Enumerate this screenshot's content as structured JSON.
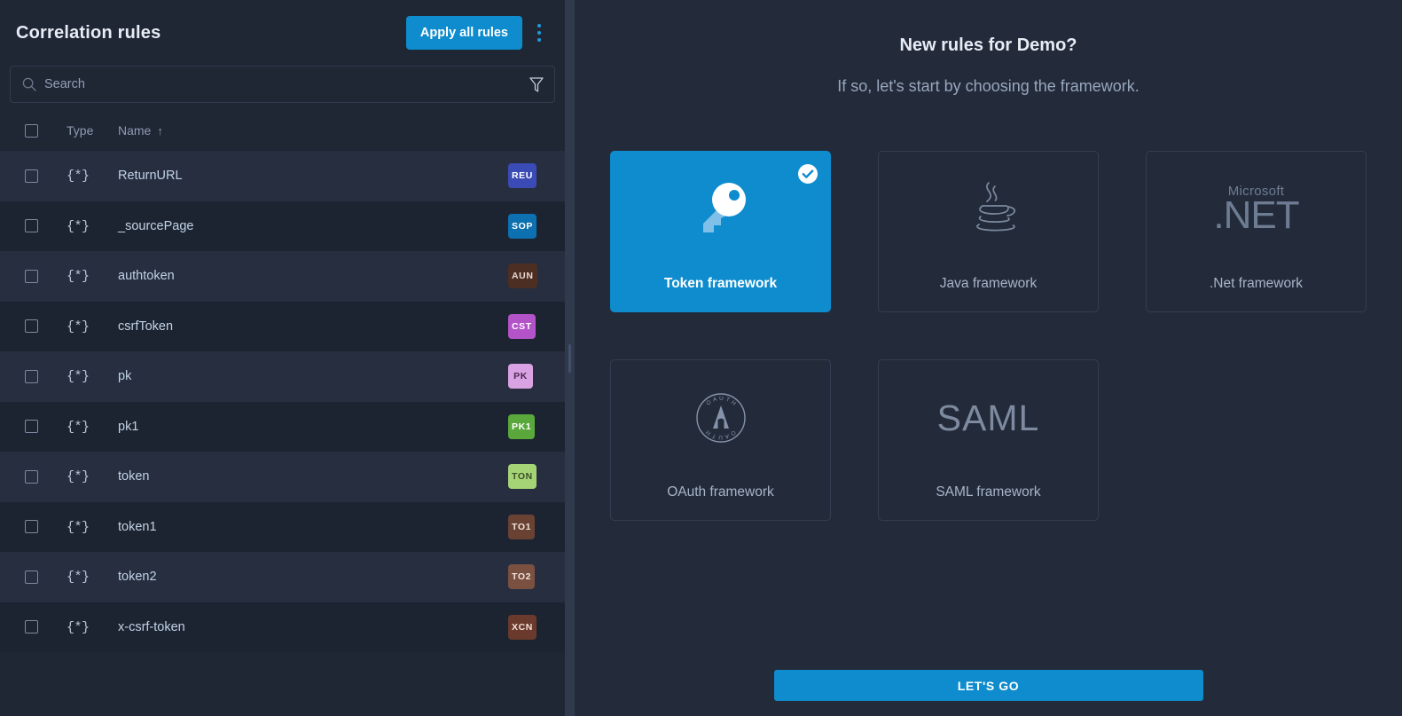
{
  "left": {
    "title": "Correlation rules",
    "apply_label": "Apply all rules",
    "kebab_icon": "more-vertical-icon",
    "search": {
      "placeholder": "Search",
      "value": "",
      "search_icon": "search-icon",
      "filter_icon": "filter-funnel-icon"
    },
    "columns": {
      "type": "Type",
      "name": "Name",
      "sort_indicator": "↑"
    },
    "type_glyph": "{*}",
    "rows": [
      {
        "name": "ReturnURL",
        "type": "{*}",
        "badge": "REU",
        "badge_bg": "#3b4bb5",
        "badge_fg": "#ffffff"
      },
      {
        "name": "_sourcePage",
        "type": "{*}",
        "badge": "SOP",
        "badge_bg": "#0d70b0",
        "badge_fg": "#ffffff"
      },
      {
        "name": "authtoken",
        "type": "{*}",
        "badge": "AUN",
        "badge_bg": "#4d2e22",
        "badge_fg": "#e8d9d2"
      },
      {
        "name": "csrfToken",
        "type": "{*}",
        "badge": "CST",
        "badge_bg": "#b254c8",
        "badge_fg": "#ffffff"
      },
      {
        "name": "pk",
        "type": "{*}",
        "badge": "PK",
        "badge_bg": "#d9a2e2",
        "badge_fg": "#4a2752"
      },
      {
        "name": "pk1",
        "type": "{*}",
        "badge": "PK1",
        "badge_bg": "#5aa83c",
        "badge_fg": "#ffffff"
      },
      {
        "name": "token",
        "type": "{*}",
        "badge": "TON",
        "badge_bg": "#a5d477",
        "badge_fg": "#3c5024"
      },
      {
        "name": "token1",
        "type": "{*}",
        "badge": "TO1",
        "badge_bg": "#6a4234",
        "badge_fg": "#f0e2da"
      },
      {
        "name": "token2",
        "type": "{*}",
        "badge": "TO2",
        "badge_bg": "#7a5040",
        "badge_fg": "#f0e2da"
      },
      {
        "name": "x-csrf-token",
        "type": "{*}",
        "badge": "XCN",
        "badge_bg": "#6a3a2c",
        "badge_fg": "#f3dfd6"
      }
    ]
  },
  "right": {
    "title": "New rules for Demo?",
    "subtitle": "If so, let's start by choosing the framework.",
    "cta_label": "LET'S GO",
    "check_icon": "check-circle-icon",
    "cards": [
      {
        "label": "Token framework",
        "art": "key-icon",
        "selected": true
      },
      {
        "label": "Java framework",
        "art": "java-coffee-icon",
        "selected": false
      },
      {
        "label": ".Net framework",
        "art": "dotnet-logo",
        "selected": false,
        "logo_small": "Microsoft",
        "logo_big": ".NET"
      },
      {
        "label": "OAuth framework",
        "art": "oauth-logo",
        "selected": false,
        "logo_ring_top": "OAUTH",
        "logo_ring_bottom": "OAUTH",
        "logo_letter": "A"
      },
      {
        "label": "SAML framework",
        "art": "saml-logo",
        "selected": false,
        "logo_big": "SAML"
      }
    ]
  },
  "colors": {
    "accent": "#0e8ccd",
    "panel_left_bg": "#1f2634",
    "panel_right_bg": "#232b3a",
    "row_alt_bg": "#262e40",
    "resizer_bg": "#303a4d"
  }
}
